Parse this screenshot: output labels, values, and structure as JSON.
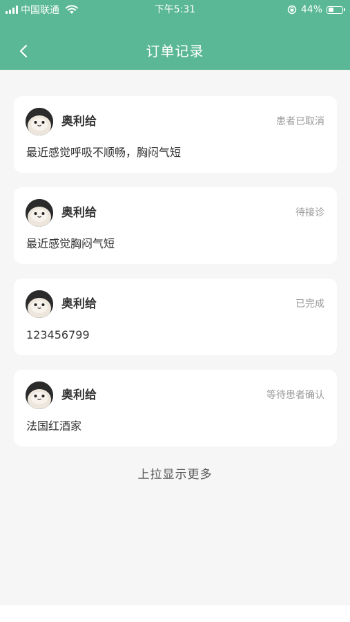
{
  "status_bar": {
    "carrier": "中国联通",
    "time": "下午5:31",
    "battery": "44%",
    "battery_level": 0.44
  },
  "header": {
    "title": "订单记录",
    "back_icon": "chevron-left-icon"
  },
  "orders": [
    {
      "name": "奥利给",
      "status": "患者已取消",
      "description": "最近感觉呼吸不顺畅，胸闷气短"
    },
    {
      "name": "奥利给",
      "status": "待接诊",
      "description": "最近感觉胸闷气短"
    },
    {
      "name": "奥利给",
      "status": "已完成",
      "description": "123456799"
    },
    {
      "name": "奥利给",
      "status": "等待患者确认",
      "description": "法国红酒家"
    }
  ],
  "footer": {
    "load_more": "上拉显示更多"
  },
  "colors": {
    "header_bg": "#5bb896",
    "page_bg": "#f6f6f6",
    "card_bg": "#ffffff",
    "status_text": "#999999",
    "primary_text": "#333333"
  }
}
